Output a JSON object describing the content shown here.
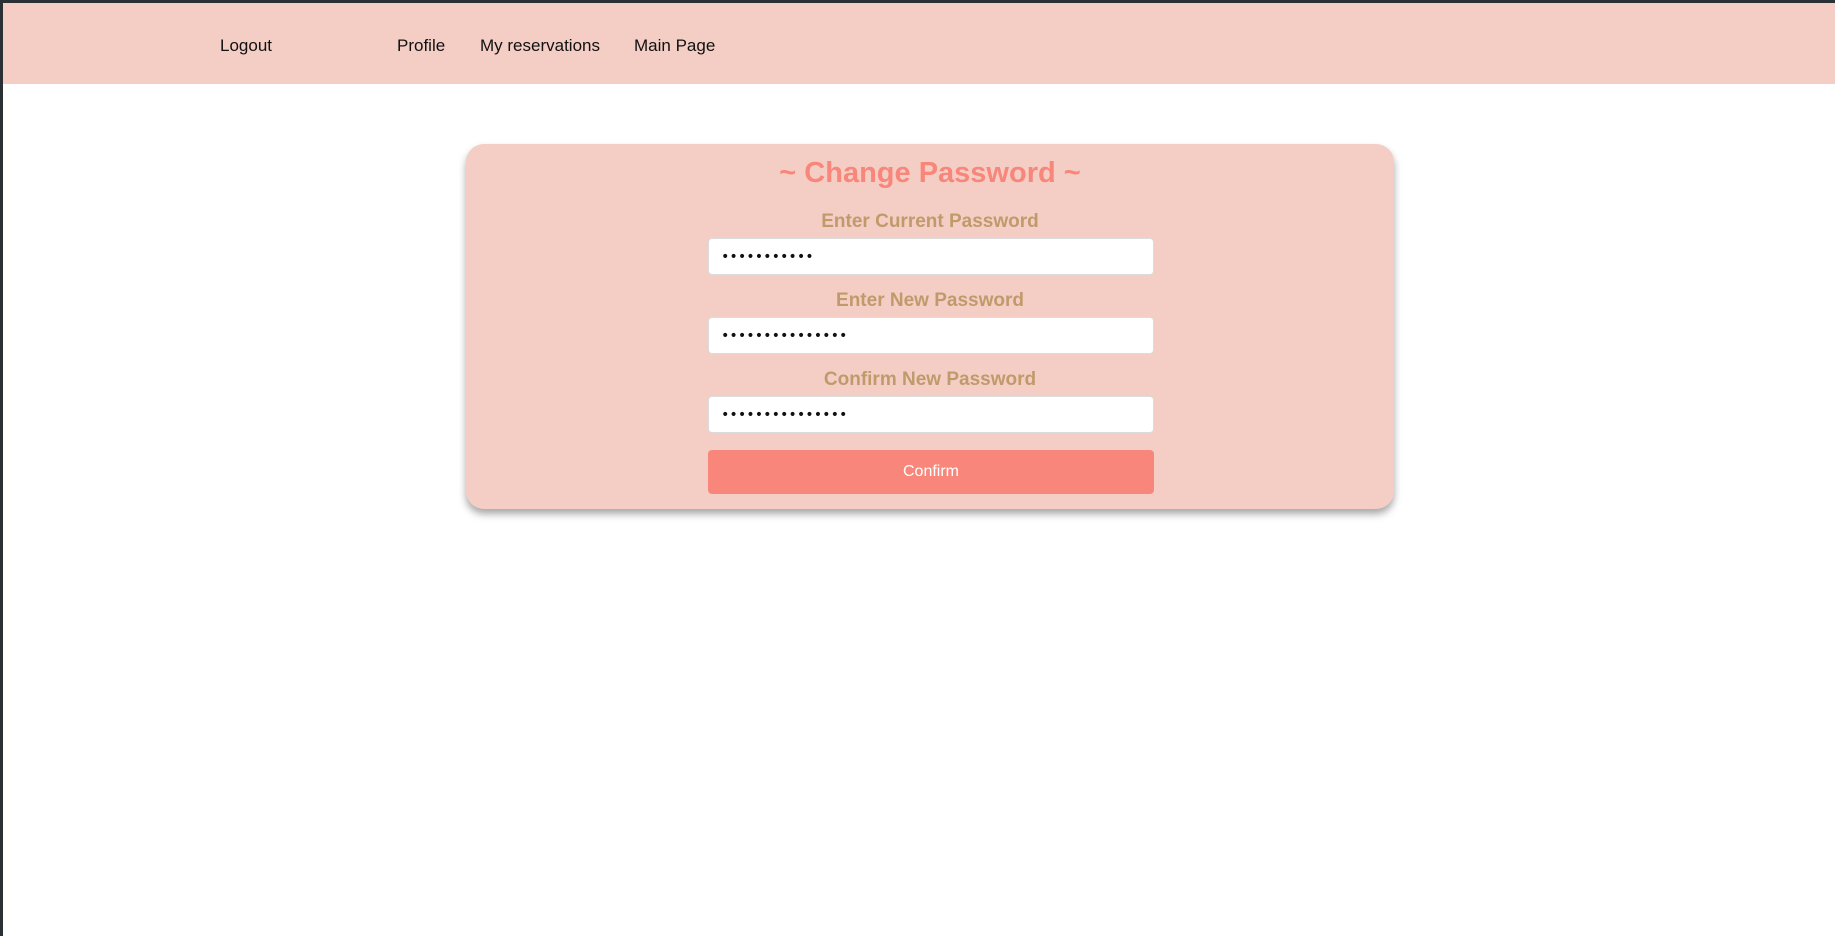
{
  "nav": {
    "logout": "Logout",
    "profile": "Profile",
    "reservations": "My reservations",
    "main_page": "Main Page"
  },
  "form": {
    "title": "~ Change Password ~",
    "current_label": "Enter Current Password",
    "current_value": "•••••••••••",
    "new_label": "Enter New Password",
    "new_value": "•••••••••••••••",
    "confirm_label": "Confirm New Password",
    "confirm_value": "•••••••••••••••",
    "submit_label": "Confirm"
  },
  "colors": {
    "nav_background": "#f4cec5",
    "card_background": "#f4cec5",
    "accent": "#f8867a",
    "label": "#c19a6b"
  }
}
